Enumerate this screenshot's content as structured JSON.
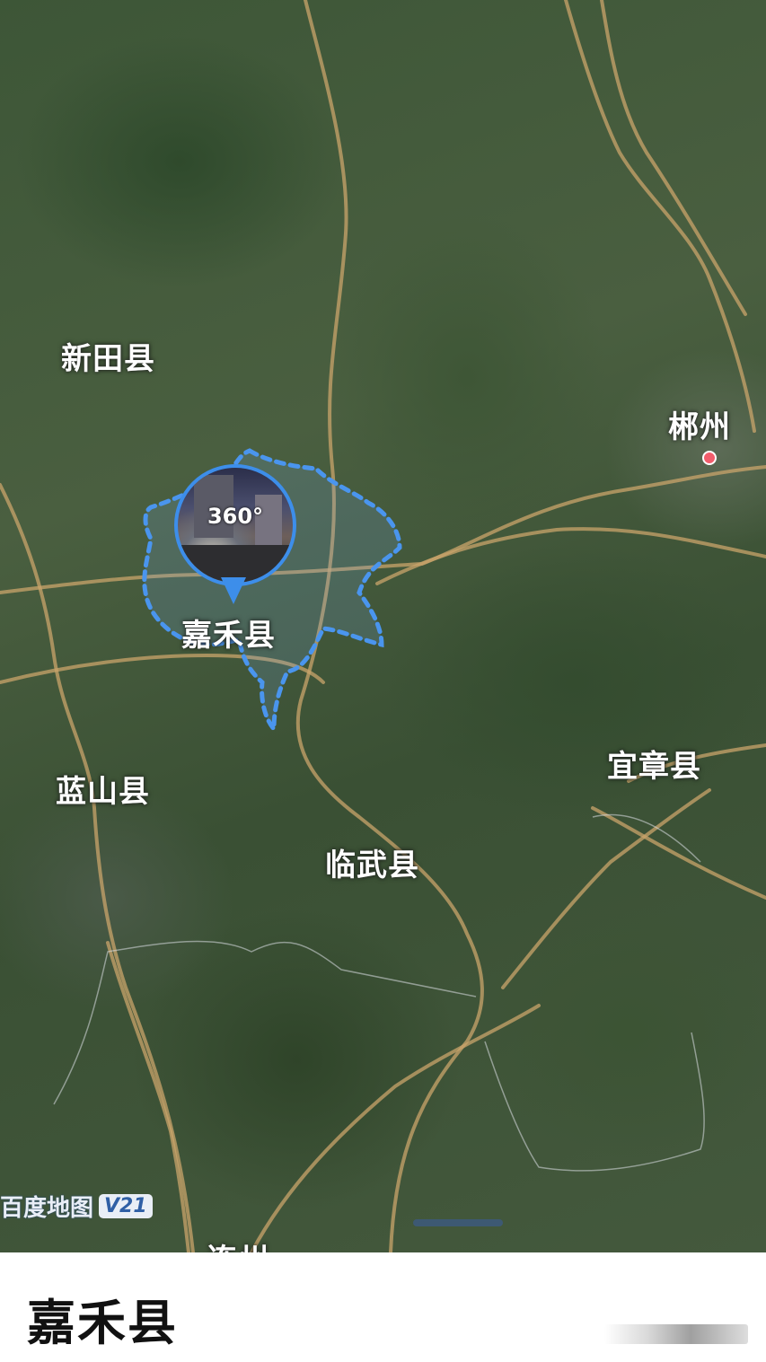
{
  "map": {
    "places": [
      {
        "name": "新田县"
      },
      {
        "name": "郴州"
      },
      {
        "name": "嘉禾县"
      },
      {
        "name": "蓝山县"
      },
      {
        "name": "宜章县"
      },
      {
        "name": "临武县"
      },
      {
        "name": "连州"
      }
    ],
    "panorama_badge": "360°",
    "logo": {
      "text": "百度地图",
      "version": "V21"
    },
    "colors": {
      "boundary": "#3d8eea",
      "road": "#c9a46b",
      "city_dot": "#f25d6c"
    }
  },
  "panel": {
    "title": "嘉禾县"
  }
}
